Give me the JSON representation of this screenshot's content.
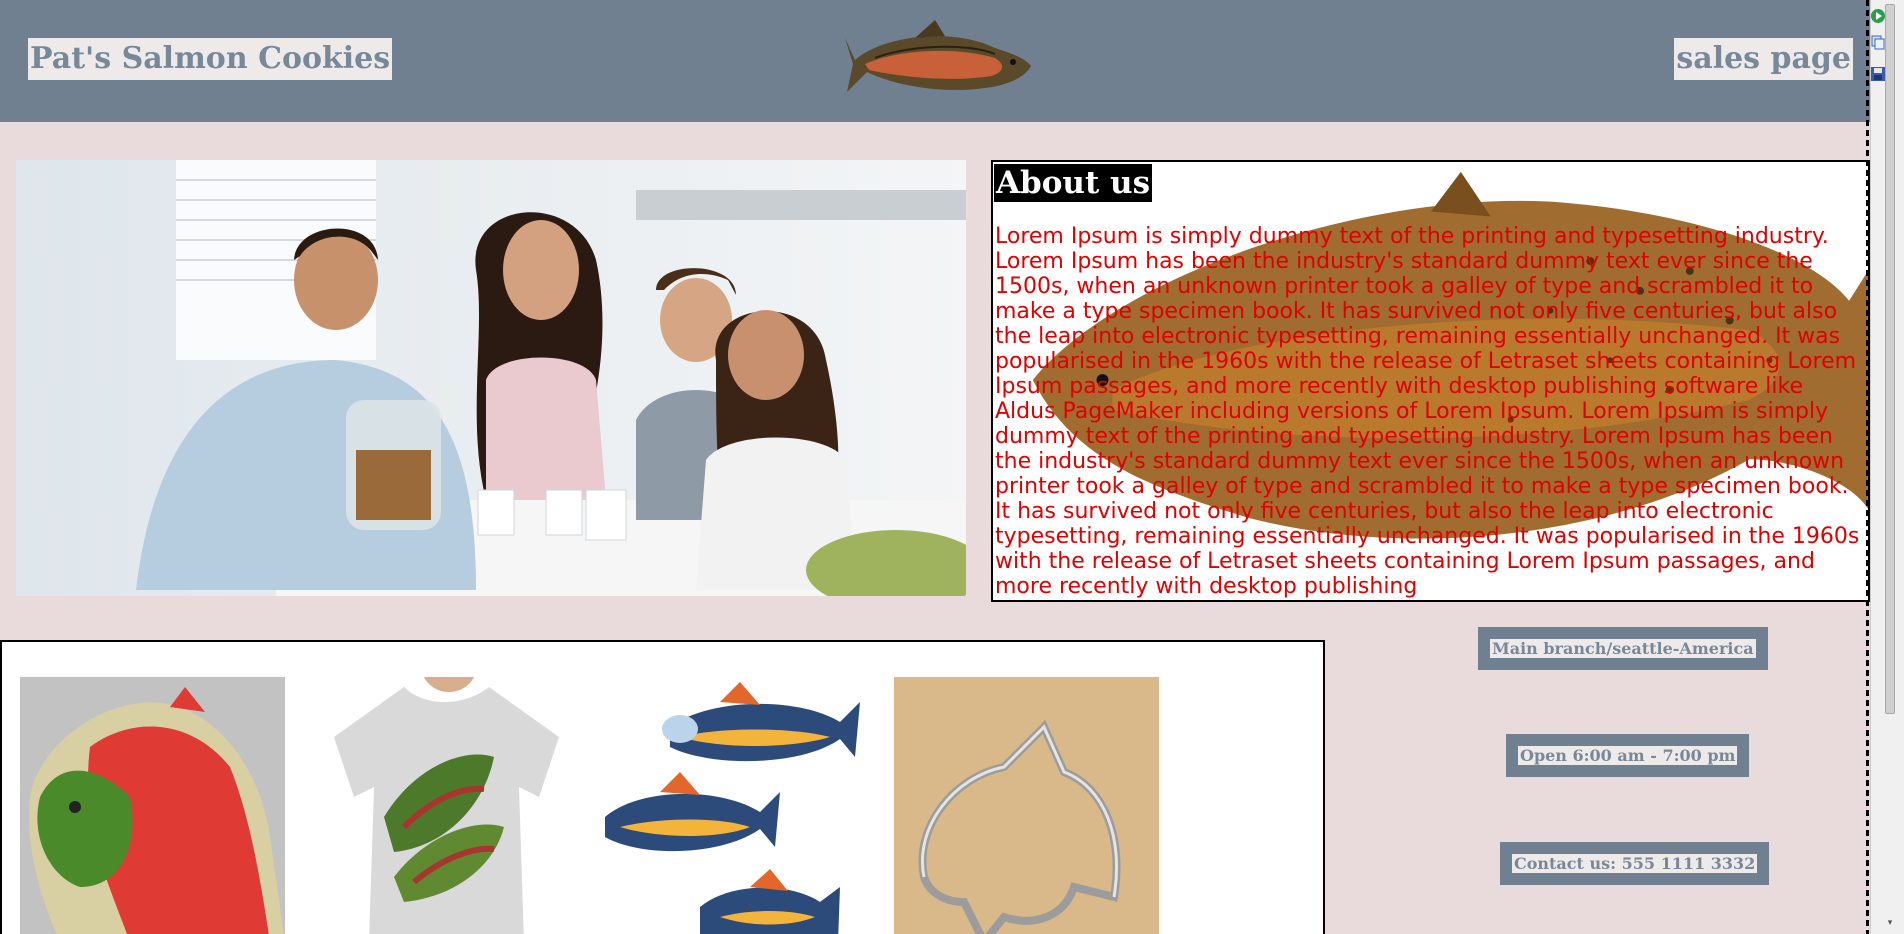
{
  "header": {
    "brand": "Pat's Salmon Cookies",
    "sales_link": "sales page",
    "logo_icon": "salmon-logo-icon",
    "bg_color": "#708090"
  },
  "about": {
    "title": "About us",
    "text": "Lorem Ipsum is simply dummy text of the printing and typesetting industry. Lorem Ipsum has been the industry's standard dummy text ever since the 1500s, when an unknown printer took a galley of type and scrambled it to make a type specimen book. It has survived not only five centuries, but also the leap into electronic typesetting, remaining essentially unchanged. It was popularised in the 1960s with the release of Letraset sheets containing Lorem Ipsum passages, and more recently with desktop publishing software like Aldus PageMaker including versions of Lorem Ipsum. Lorem Ipsum is simply dummy text of the printing and typesetting industry. Lorem Ipsum has been the industry's standard dummy text ever since the 1500s, when an unknown printer took a galley of type and scrambled it to make a type specimen book. It has survived not only five centuries, but also the leap into electronic typesetting, remaining essentially unchanged. It was popularised in the 1960s with the release of Letraset sheets containing Lorem Ipsum passages, and more recently with desktop publishing",
    "text_color": "#e00000"
  },
  "info": {
    "branch": "Main branch/seattle-America",
    "hours": "Open 6:00 am - 7:00 pm",
    "contact": "Contact us: 555 1111 3332"
  },
  "products": [
    {
      "icon": "salmon-cookie-icon"
    },
    {
      "icon": "salmon-tshirt-icon"
    },
    {
      "icon": "salmon-cookies-set-icon"
    },
    {
      "icon": "cookie-cutter-icon"
    }
  ]
}
